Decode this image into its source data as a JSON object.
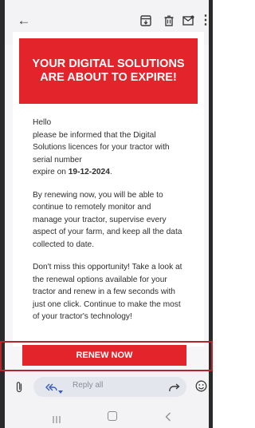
{
  "email": {
    "banner_title": "YOUR DIGITAL SOLUTIONS ARE ABOUT TO EXPIRE!",
    "greeting": "Hello",
    "para1_lines": [
      "please be informed that the Digital",
      "Solutions licences for your tractor with",
      "serial number"
    ],
    "expire_prefix": "expire on ",
    "expire_date": "19-12-2024",
    "expire_suffix": ".",
    "para2_lines": [
      "By renewing now, you will be able to",
      "continue to remotely monitor and",
      "manage your tractor, supervise every",
      "aspect of your farm, and keep all the data",
      "collected to date."
    ],
    "para3_lines": [
      "Don't miss this opportunity! Take a look at",
      "the renewal options available for your",
      "tractor and renew in a few seconds with",
      "just one click. Continue to make the most",
      "of your tractor's technology!"
    ],
    "renew_button": "RENEW NOW"
  },
  "reply": {
    "placeholder": "Reply all"
  },
  "icons": {
    "toolbar": [
      "back-icon",
      "archive-icon",
      "delete-icon",
      "mark-unread-icon",
      "more-icon"
    ],
    "reply": [
      "attachment-icon",
      "reply-all-icon",
      "chevron-down-icon",
      "forward-icon",
      "emoji-icon"
    ],
    "nav": [
      "recent-apps-icon",
      "home-icon",
      "nav-back-icon"
    ]
  },
  "colors": {
    "brand_red": "#e3242b",
    "highlight_border": "#b4262c",
    "reply_accent": "#3b5cb8"
  }
}
